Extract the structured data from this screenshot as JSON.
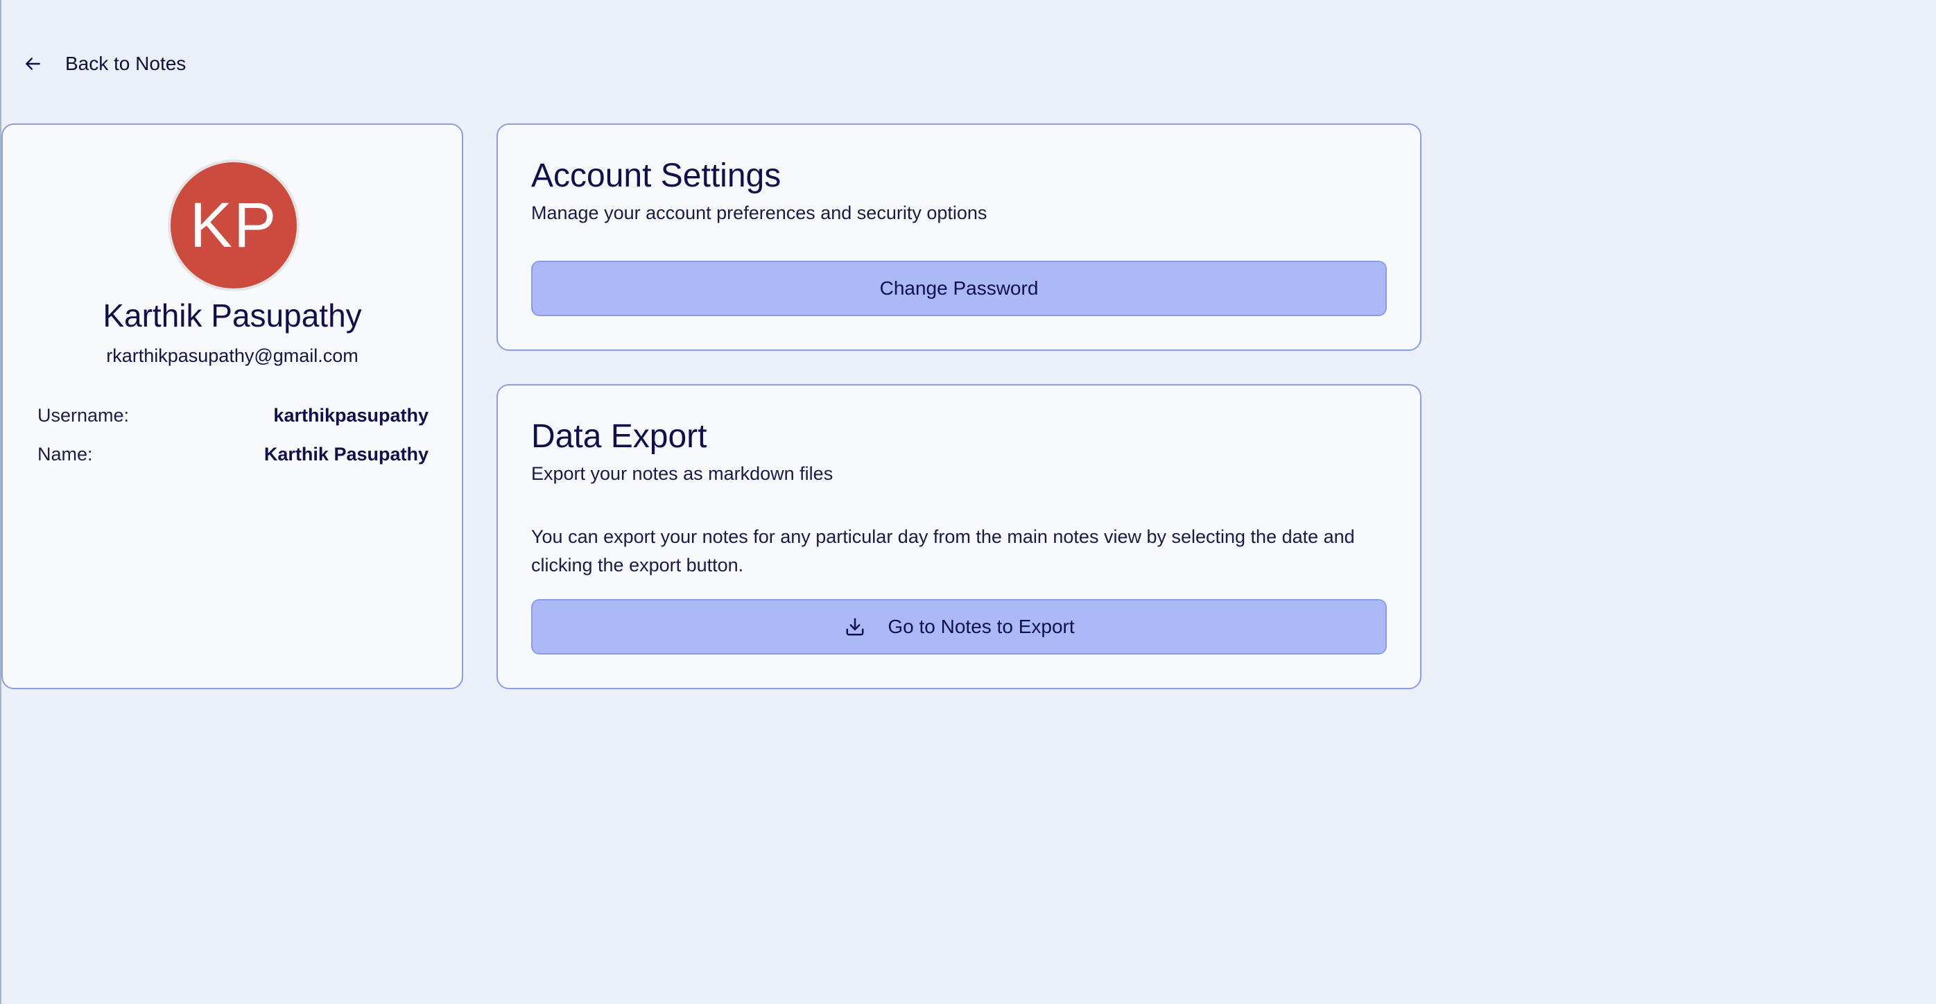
{
  "nav": {
    "back_label": "Back to Notes",
    "back_icon": "arrow-left-icon"
  },
  "profile": {
    "initials": "KP",
    "avatar_color": "#cc4a3e",
    "full_name": "Karthik Pasupathy",
    "email": "rkarthikpasupathy@gmail.com",
    "fields": [
      {
        "label": "Username:",
        "value": "karthikpasupathy"
      },
      {
        "label": "Name:",
        "value": "Karthik Pasupathy"
      }
    ]
  },
  "account_settings": {
    "title": "Account Settings",
    "subtitle": "Manage your account preferences and security options",
    "change_password_label": "Change Password"
  },
  "data_export": {
    "title": "Data Export",
    "subtitle": "Export your notes as markdown files",
    "description": "You can export your notes for any particular day from the main notes view by selecting the date and clicking the export button.",
    "export_button_label": "Go to Notes to Export",
    "export_icon": "download-icon"
  },
  "colors": {
    "background": "#ebeff7",
    "card_border": "#8e9de2",
    "button_fill": "#abbaf6",
    "text_primary": "#12104a"
  }
}
